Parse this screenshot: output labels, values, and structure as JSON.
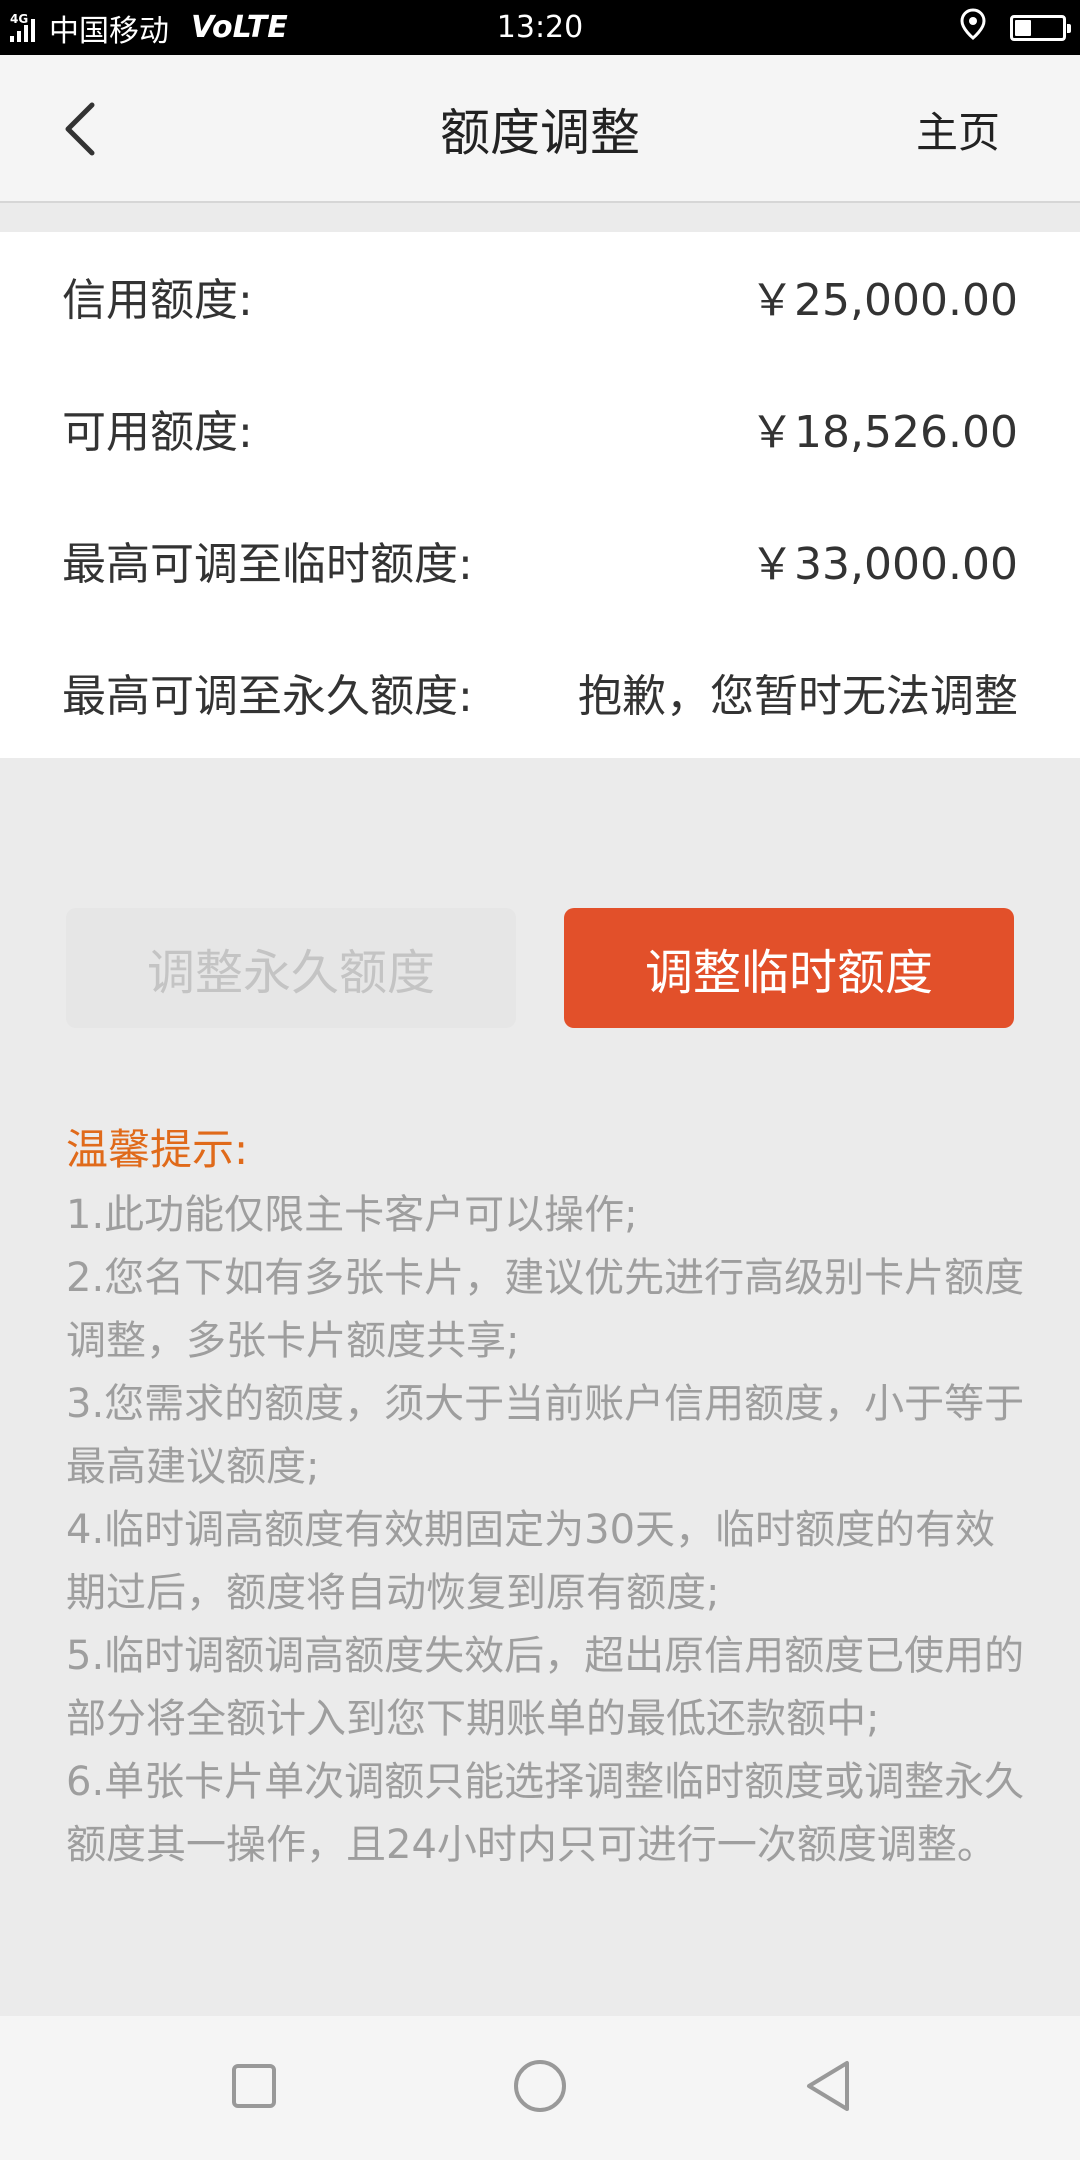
{
  "status_bar": {
    "network": "4G",
    "carrier": "中国移动",
    "volte": "VoLTE",
    "time": "13:20",
    "battery_level": 0.35,
    "icons": [
      "signal-icon",
      "location-icon",
      "battery-icon"
    ]
  },
  "header": {
    "title": "额度调整",
    "home_label": "主页",
    "back_icon": "back-arrow-icon"
  },
  "credit_info": {
    "rows": [
      {
        "label": "信用额度:",
        "value": "￥25,000.00"
      },
      {
        "label": "可用额度:",
        "value": "￥18,526.00"
      },
      {
        "label": "最高可调至临时额度:",
        "value": "￥33,000.00"
      },
      {
        "label": "最高可调至永久额度:",
        "value": "抱歉，您暂时无法调整"
      }
    ]
  },
  "actions": {
    "permanent_label": "调整永久额度",
    "temporary_label": "调整临时额度",
    "permanent_enabled": false,
    "accent_color": "#e2502a"
  },
  "tips": {
    "title": "温馨提示:",
    "items": [
      "1.此功能仅限主卡客户可以操作;",
      "2.您名下如有多张卡片，建议优先进行高级别卡片额度调整，多张卡片额度共享;",
      "3.您需求的额度，须大于当前账户信用额度，小于等于最高建议额度;",
      "4.临时调高额度有效期固定为30天，临时额度的有效期过后，额度将自动恢复到原有额度;",
      "5.临时调额调高额度失效后，超出原信用额度已使用的部分将全额计入到您下期账单的最低还款额中;",
      "6.单张卡片单次调额只能选择调整临时额度或调整永久额度其一操作，且24小时内只可进行一次额度调整。"
    ]
  },
  "nav_bar": {
    "buttons": [
      "recent-apps-icon",
      "home-circle-icon",
      "back-triangle-icon"
    ]
  }
}
